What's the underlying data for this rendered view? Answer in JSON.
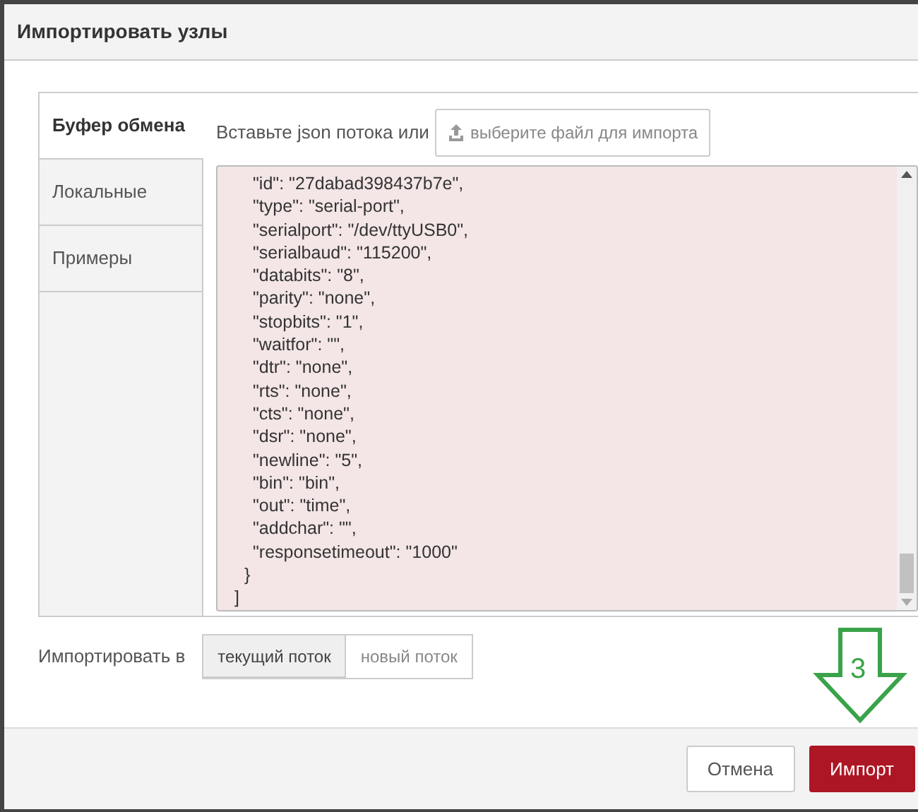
{
  "dialog": {
    "title": "Импортировать узлы"
  },
  "tabs": [
    {
      "label": "Буфер обмена",
      "selected": true
    },
    {
      "label": "Локальные",
      "selected": false
    },
    {
      "label": "Примеры",
      "selected": false
    }
  ],
  "clipboard": {
    "prompt": "Вставьте json потока или",
    "file_button": "выберите файл для импорта",
    "lines": [
      {
        "kind": "prop",
        "text": "\"id\": \"27dabad398437b7e\","
      },
      {
        "kind": "prop",
        "text": "\"type\": \"serial-port\","
      },
      {
        "kind": "prop",
        "text": "\"serialport\": \"/dev/ttyUSB0\","
      },
      {
        "kind": "prop",
        "text": "\"serialbaud\": \"115200\","
      },
      {
        "kind": "prop",
        "text": "\"databits\": \"8\","
      },
      {
        "kind": "prop",
        "text": "\"parity\": \"none\","
      },
      {
        "kind": "prop",
        "text": "\"stopbits\": \"1\","
      },
      {
        "kind": "prop",
        "text": "\"waitfor\": \"\","
      },
      {
        "kind": "prop",
        "text": "\"dtr\": \"none\","
      },
      {
        "kind": "prop",
        "text": "\"rts\": \"none\","
      },
      {
        "kind": "prop",
        "text": "\"cts\": \"none\","
      },
      {
        "kind": "prop",
        "text": "\"dsr\": \"none\","
      },
      {
        "kind": "prop",
        "text": "\"newline\": \"5\","
      },
      {
        "kind": "prop",
        "text": "\"bin\": \"bin\","
      },
      {
        "kind": "prop",
        "text": "\"out\": \"time\","
      },
      {
        "kind": "prop",
        "text": "\"addchar\": \"\","
      },
      {
        "kind": "prop",
        "text": "\"responsetimeout\": \"1000\""
      },
      {
        "kind": "brace",
        "text": "}"
      },
      {
        "kind": "bracket",
        "text": "]"
      }
    ]
  },
  "import_to": {
    "label": "Импортировать в",
    "options": [
      {
        "label": "текущий поток",
        "selected": true
      },
      {
        "label": "новый поток",
        "selected": false
      }
    ]
  },
  "annotation": {
    "text": "3"
  },
  "buttons": [
    {
      "kind": "secondary",
      "label": "Отмена"
    },
    {
      "kind": "primary",
      "label": "Импорт"
    }
  ]
}
